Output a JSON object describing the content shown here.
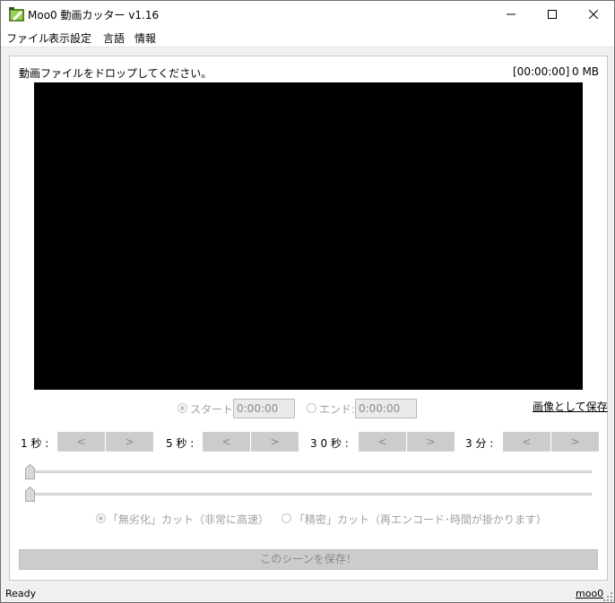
{
  "window": {
    "title": "Moo0 動画カッター v1.16"
  },
  "menu": {
    "items": [
      "ファイル",
      "表示設定",
      "言語",
      "情報"
    ]
  },
  "info": {
    "drop_text": "動画ファイルをドロップしてください。",
    "time": "[00:00:00]",
    "size": "0 MB"
  },
  "range": {
    "start_label": "スタート:",
    "start_value": "0:00:00",
    "end_label": "エンド:",
    "end_value": "0:00:00",
    "save_image_link": "画像として保存"
  },
  "steps": [
    {
      "label": "1 秒 :",
      "prev": "<",
      "next": ">"
    },
    {
      "label": "5 秒 :",
      "prev": "<",
      "next": ">"
    },
    {
      "label": "3 0 秒 :",
      "prev": "<",
      "next": ">"
    },
    {
      "label": "3 分 :",
      "prev": "<",
      "next": ">"
    }
  ],
  "cut_mode": {
    "lossless": "「無劣化」カット（非常に高速）",
    "precise": "「精密」カット（再エンコード･時間が掛かります）"
  },
  "save_scene_label": "このシーンを保存！",
  "status": {
    "text": "Ready",
    "link": "moo0"
  }
}
